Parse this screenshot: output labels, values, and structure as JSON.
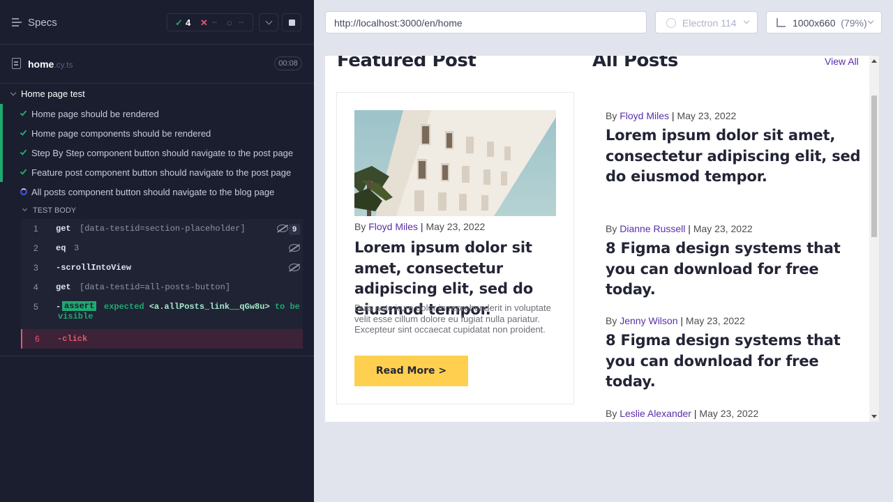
{
  "runner": {
    "title": "Specs",
    "stats": {
      "passed": "4",
      "failed": "--",
      "pending": "--"
    },
    "file": {
      "name": "home",
      "ext": ".cy.ts",
      "duration": "00:08"
    },
    "suite": "Home page test",
    "tests": [
      {
        "label": "Home page should be rendered",
        "state": "passed"
      },
      {
        "label": "Home page components should be rendered",
        "state": "passed"
      },
      {
        "label": "Step By Step component button should navigate to the post page",
        "state": "passed"
      },
      {
        "label": "Feature post component button should navigate to the post page",
        "state": "passed"
      },
      {
        "label": "All posts component button should navigate to the blog page",
        "state": "running"
      }
    ],
    "test_body_label": "TEST BODY",
    "commands": [
      {
        "num": "1",
        "name": "get",
        "message": "[data-testid=section-placeholder]",
        "count": "9"
      },
      {
        "num": "2",
        "name": "eq",
        "message": "3"
      },
      {
        "num": "3",
        "name": "-scrollIntoView",
        "message": ""
      },
      {
        "num": "4",
        "name": "get",
        "message": "[data-testid=all-posts-button]"
      },
      {
        "num": "5",
        "name": "-",
        "badge": "assert",
        "message_pre": "expected ",
        "message_el": "<a.allPosts_link__qGw8u>",
        "message_post": " to be",
        "message_line2": "visible"
      },
      {
        "num": "6",
        "name": "-click",
        "message": "",
        "state": "failed"
      }
    ]
  },
  "browser_bar": {
    "url": "http://localhost:3000/en/home",
    "browser": "Electron 114",
    "viewport": "1000x660",
    "zoom": "(79%)"
  },
  "app": {
    "featured_heading": "Featured Post",
    "all_posts_heading": "All Posts",
    "view_all": "View All",
    "featured": {
      "by": "By",
      "author": "Floyd Miles",
      "sep": "|",
      "date": "May 23, 2022",
      "title": "Lorem ipsum dolor sit amet, consectetur adipiscing elit, sed do eiusmod tempor.",
      "excerpt": "Duis aute irure dolor in reprehenderit in voluptate velit esse cillum dolore eu fugiat nulla pariatur. Excepteur sint occaecat cupidatat non proident.",
      "button": "Read More >"
    },
    "posts": [
      {
        "by": "By",
        "author": "Floyd Miles",
        "sep": "|",
        "date": "May 23, 2022",
        "title": "Lorem ipsum dolor sit amet, consectetur adipiscing elit, sed do eiusmod tempor."
      },
      {
        "by": "By",
        "author": "Dianne Russell",
        "sep": "|",
        "date": "May 23, 2022",
        "title": "8 Figma design systems that you can download for free today."
      },
      {
        "by": "By",
        "author": "Jenny Wilson",
        "sep": "|",
        "date": "May 23, 2022",
        "title": "8 Figma design systems that you can download for free today."
      },
      {
        "by": "By",
        "author": "Leslie Alexander",
        "sep": "|",
        "date": "May 23, 2022",
        "title": ""
      }
    ]
  },
  "colors": {
    "passed": "#1fa971",
    "failed": "#e45770",
    "accent": "#592ea9",
    "button": "#ffd050"
  }
}
